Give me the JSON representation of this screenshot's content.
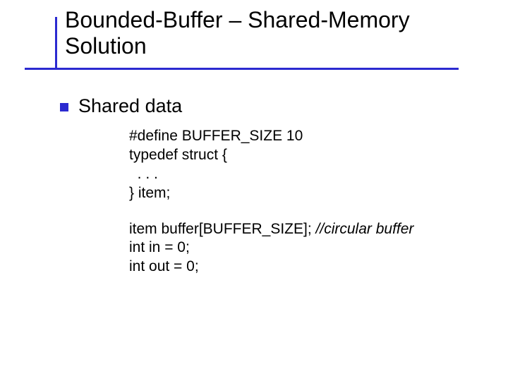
{
  "header": {
    "title_line1": "Bounded-Buffer – Shared-Memory",
    "title_line2": "Solution"
  },
  "body": {
    "bullet_label": "Shared data",
    "code": {
      "l1": "#define BUFFER_SIZE 10",
      "l2": "typedef struct {",
      "l3": "  . . .",
      "l4": "} item;",
      "l5a": "item buffer[BUFFER_SIZE]; ",
      "l5b": "//circular buffer",
      "l6": "int in = 0;",
      "l7": "int out = 0;"
    }
  }
}
